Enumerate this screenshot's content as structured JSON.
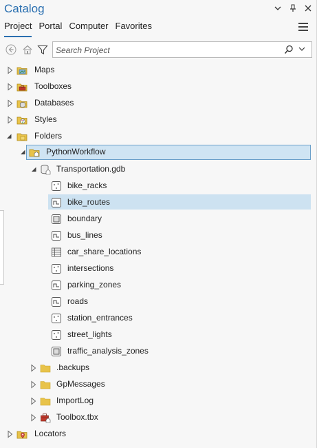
{
  "window": {
    "title": "Catalog",
    "controls": [
      "chevron-down-icon",
      "pin-icon",
      "close-icon"
    ]
  },
  "tabs": [
    {
      "label": "Project",
      "active": true
    },
    {
      "label": "Portal",
      "active": false
    },
    {
      "label": "Computer",
      "active": false
    },
    {
      "label": "Favorites",
      "active": false
    }
  ],
  "toolbar": {
    "search_placeholder": "Search Project"
  },
  "tree": {
    "maps": "Maps",
    "toolboxes": "Toolboxes",
    "databases": "Databases",
    "styles": "Styles",
    "folders": "Folders",
    "pythonworkflow": "PythonWorkflow",
    "gdb": "Transportation.gdb",
    "fc": [
      {
        "label": "bike_racks",
        "type": "point"
      },
      {
        "label": "bike_routes",
        "type": "line",
        "selected": true
      },
      {
        "label": "boundary",
        "type": "polygon"
      },
      {
        "label": "bus_lines",
        "type": "line"
      },
      {
        "label": "car_share_locations",
        "type": "table"
      },
      {
        "label": "intersections",
        "type": "point"
      },
      {
        "label": "parking_zones",
        "type": "line"
      },
      {
        "label": "roads",
        "type": "line"
      },
      {
        "label": "station_entrances",
        "type": "point"
      },
      {
        "label": "street_lights",
        "type": "point"
      },
      {
        "label": "traffic_analysis_zones",
        "type": "polygon"
      }
    ],
    "backups": ".backups",
    "gpmessages": "GpMessages",
    "importlog": "ImportLog",
    "toolbox_tbx": "Toolbox.tbx",
    "locators": "Locators"
  },
  "colors": {
    "title": "#2a6fb0",
    "selection": "#cde2f1",
    "selection_border": "#6a9fc9",
    "folder": "#e8c34a"
  }
}
